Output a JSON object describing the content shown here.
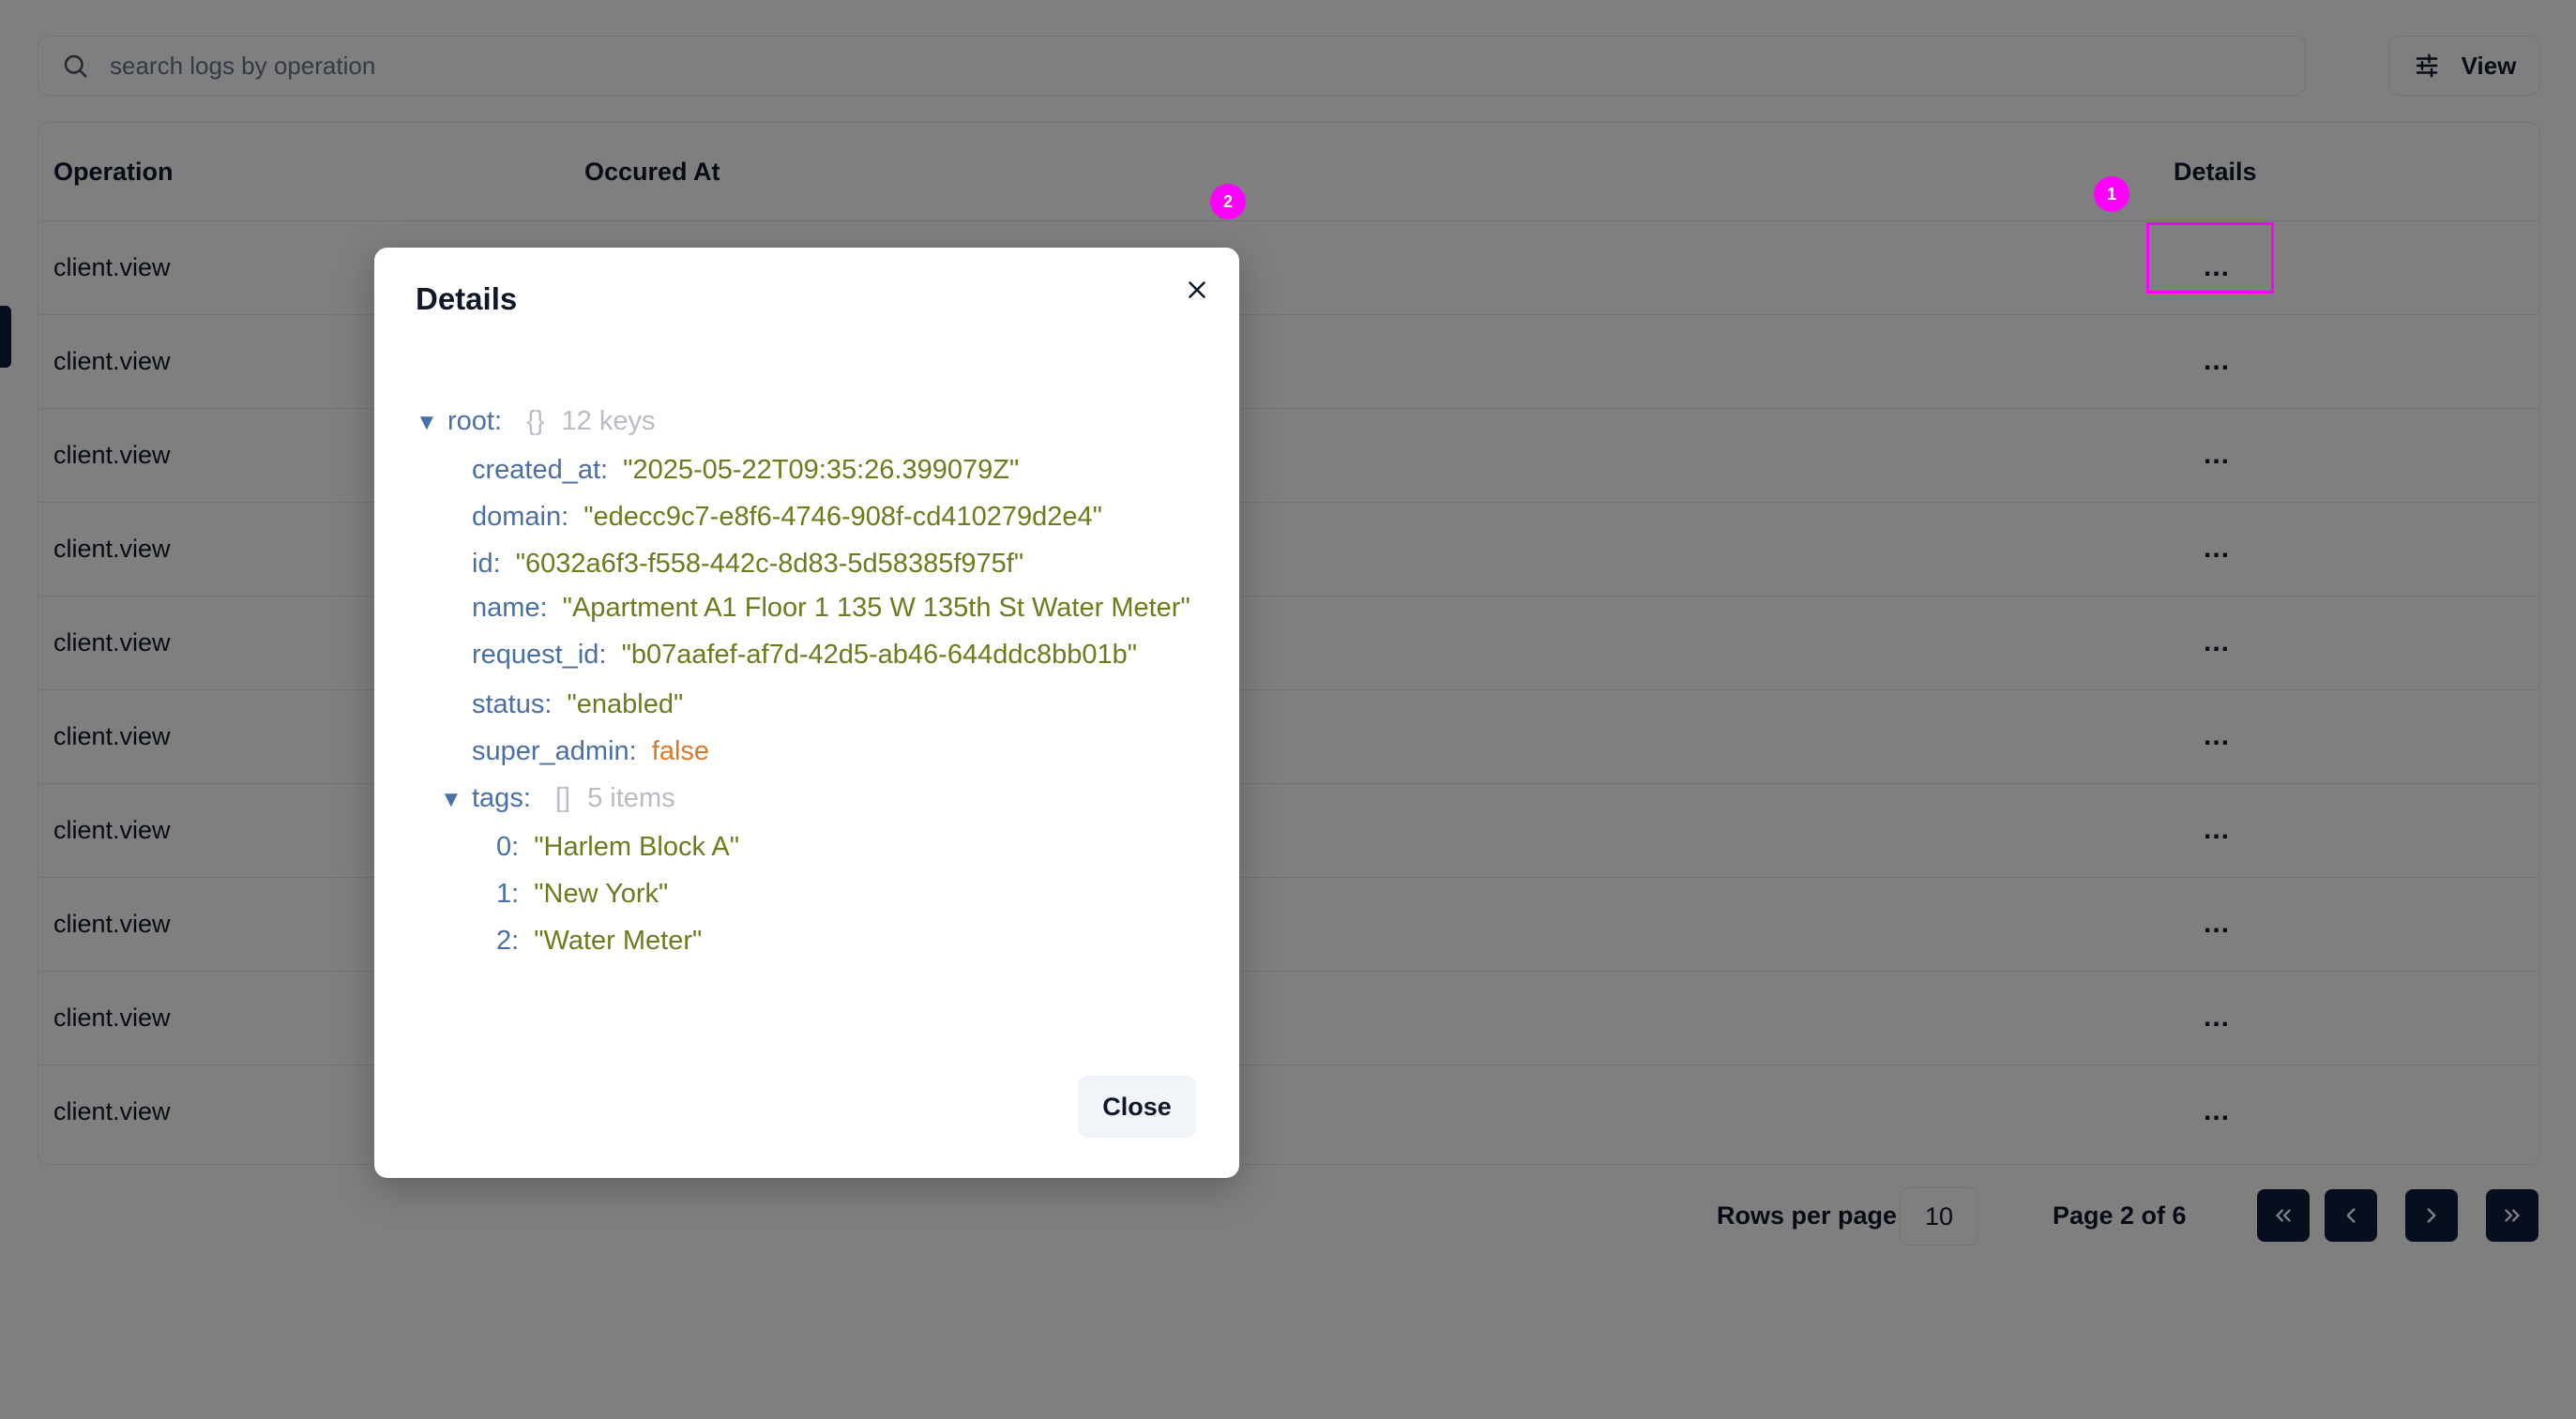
{
  "search": {
    "placeholder": "search logs by operation",
    "value": ""
  },
  "toolbar": {
    "view_label": "View"
  },
  "table": {
    "headers": {
      "operation": "Operation",
      "occured_at": "Occured At",
      "details": "Details"
    },
    "rows": [
      {
        "operation": "client.view",
        "occured_at": "",
        "details": "..."
      },
      {
        "operation": "client.view",
        "occured_at": "",
        "details": "..."
      },
      {
        "operation": "client.view",
        "occured_at": "",
        "details": "..."
      },
      {
        "operation": "client.view",
        "occured_at": "",
        "details": "..."
      },
      {
        "operation": "client.view",
        "occured_at": "",
        "details": "..."
      },
      {
        "operation": "client.view",
        "occured_at": "",
        "details": "..."
      },
      {
        "operation": "client.view",
        "occured_at": "",
        "details": "..."
      },
      {
        "operation": "client.view",
        "occured_at": "",
        "details": "..."
      },
      {
        "operation": "client.view",
        "occured_at": "",
        "details": "..."
      },
      {
        "operation": "client.view",
        "occured_at": "",
        "details": "..."
      }
    ]
  },
  "pagination": {
    "rows_per_page_label": "Rows per page",
    "rows_per_page_value": "10",
    "page_label": "Page 2 of 6"
  },
  "modal": {
    "title": "Details",
    "close_label": "Close",
    "json": {
      "root_key": "root:",
      "root_meta_brace": "{}",
      "root_meta_count": "12 keys",
      "fields": [
        {
          "key": "created_at:",
          "value": "\"2025-05-22T09:35:26.399079Z\"",
          "type": "string"
        },
        {
          "key": "domain:",
          "value": "\"edecc9c7-e8f6-4746-908f-cd410279d2e4\"",
          "type": "string"
        },
        {
          "key": "id:",
          "value": "\"6032a6f3-f558-442c-8d83-5d58385f975f\"",
          "type": "string"
        },
        {
          "key": "name:",
          "value": "\"Apartment A1 Floor 1 135 W 135th St Water Meter\"",
          "type": "string"
        },
        {
          "key": "request_id:",
          "value": "\"b07aafef-af7d-42d5-ab46-644ddc8bb01b\"",
          "type": "string"
        },
        {
          "key": "status:",
          "value": "\"enabled\"",
          "type": "string"
        },
        {
          "key": "super_admin:",
          "value": "false",
          "type": "boolean"
        }
      ],
      "tags_key": "tags:",
      "tags_meta_brace": "[]",
      "tags_meta_count": "5 items",
      "tags": [
        {
          "key": "0:",
          "value": "\"Harlem Block A\""
        },
        {
          "key": "1:",
          "value": "\"New York\""
        },
        {
          "key": "2:",
          "value": "\"Water Meter\""
        }
      ]
    }
  },
  "annotations": {
    "badge_1": "1",
    "badge_2": "2"
  },
  "colors": {
    "accent": "#0f1f3d",
    "json_key": "#4a6fa5",
    "json_string": "#6b7c1d",
    "json_boolean": "#d97a2b",
    "annotation": "#ff00ff"
  },
  "icons": {
    "search": "search-icon",
    "view": "sliders-icon",
    "close": "close-icon",
    "first": "chevrons-left-icon",
    "prev": "chevron-left-icon",
    "next": "chevron-right-icon",
    "last": "chevrons-right-icon"
  }
}
